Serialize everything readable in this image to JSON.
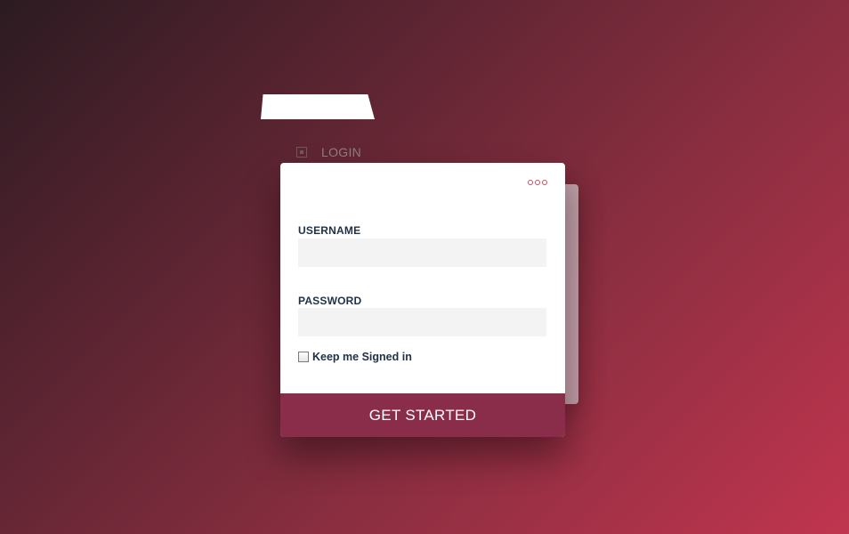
{
  "header": {
    "tab_label": "LOGIN"
  },
  "form": {
    "username_label": "USERNAME",
    "username_value": "",
    "password_label": "PASSWORD",
    "password_value": "",
    "remember_label": "Keep me Signed in",
    "remember_checked": false,
    "submit_label": "GET STARTED"
  },
  "icons": {
    "login_icon": "login-square-icon",
    "more_icon": "more-dots-icon"
  },
  "colors": {
    "background_start": "#2c1b22",
    "background_end": "#c0354f",
    "button": "#8a2d4b",
    "label_text": "#1f3146",
    "input_bg": "#f3f3f3",
    "dots_accent": "#d04a5e"
  }
}
